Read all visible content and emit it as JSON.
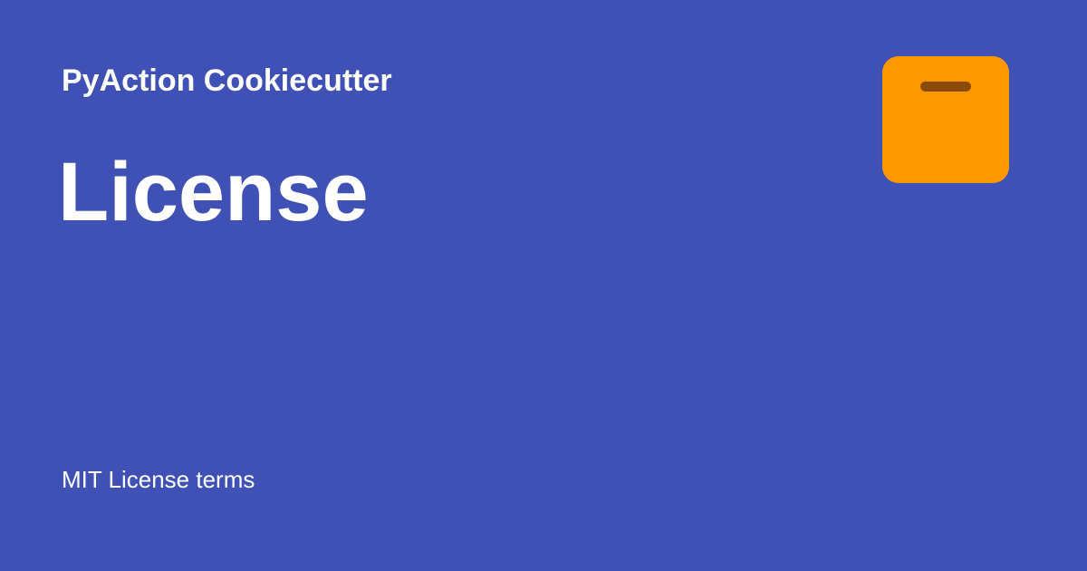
{
  "card": {
    "site_name": "PyAction Cookiecutter",
    "page_title": "License",
    "description": "MIT License terms",
    "logo_icon": "archive-box-icon"
  },
  "colors": {
    "background": "#3f51b5",
    "text": "#ffffff",
    "logo_fill": "#ff9800",
    "logo_slot": "#8a4b08"
  }
}
